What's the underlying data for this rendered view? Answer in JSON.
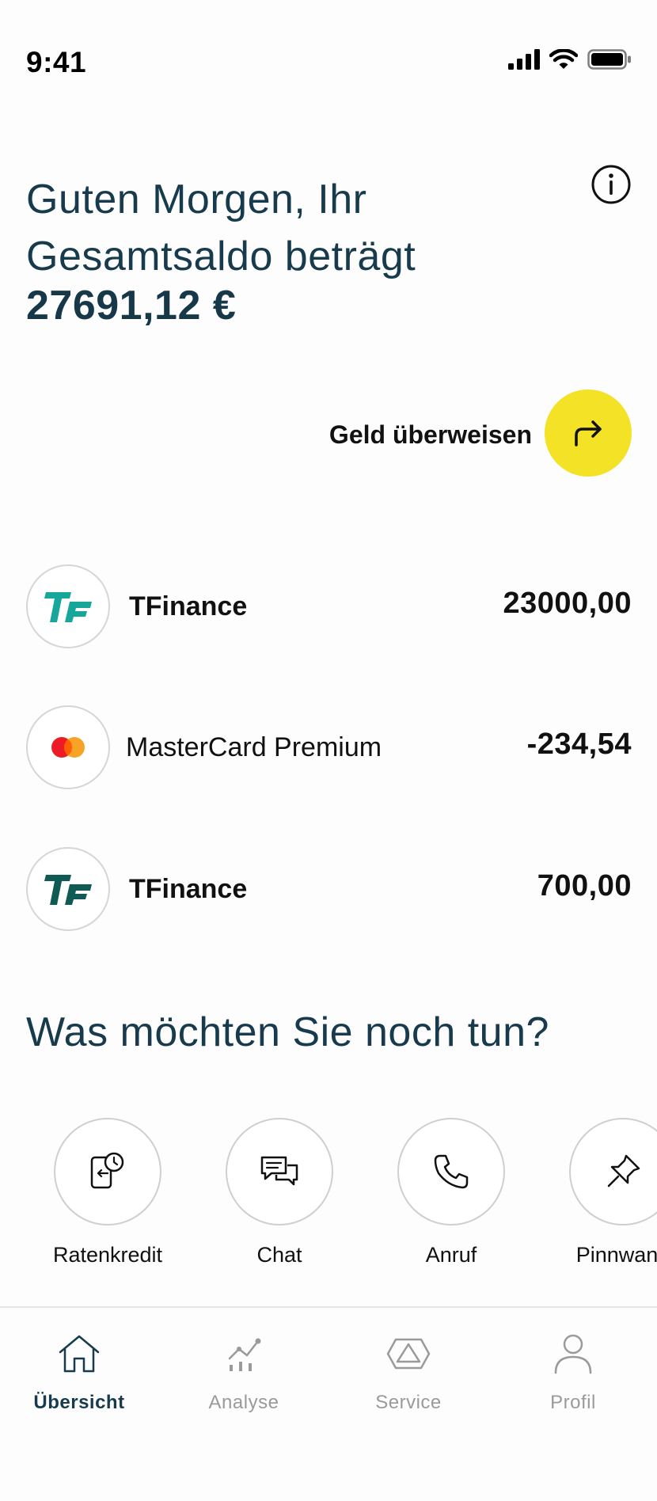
{
  "status_bar": {
    "time": "9:41",
    "icons": [
      "cellular-signal-icon",
      "wifi-icon",
      "battery-icon"
    ]
  },
  "header": {
    "info_icon": "info-icon",
    "greeting_line1": "Guten Morgen, Ihr",
    "greeting_line2": "Gesamtsaldo beträgt",
    "balance": "27691,12 €"
  },
  "transfer": {
    "label": "Geld überweisen",
    "icon": "arrow-turn-right-icon",
    "accent_color": "#f3e226"
  },
  "accounts": [
    {
      "name": "TFinance",
      "amount": "23000,00",
      "logo": "tfinance-logo",
      "logo_color": "#17a69a"
    },
    {
      "name": "MasterCard Premium",
      "amount": "-234,54",
      "logo": "mastercard-logo"
    },
    {
      "name": "TFinance",
      "amount": "700,00",
      "logo": "tfinance-logo",
      "logo_color": "#0f5a55"
    }
  ],
  "quick_actions": {
    "title": "Was möchten Sie noch tun?",
    "items": [
      {
        "label": "Ratenkredit",
        "icon": "loan-phone-icon"
      },
      {
        "label": "Chat",
        "icon": "chat-bubbles-icon"
      },
      {
        "label": "Anruf",
        "icon": "phone-icon"
      },
      {
        "label": "Pinnwand",
        "icon": "pin-icon"
      }
    ]
  },
  "bottom_nav": {
    "items": [
      {
        "label": "Übersicht",
        "icon": "home-icon",
        "active": true
      },
      {
        "label": "Analyse",
        "icon": "analytics-icon",
        "active": false
      },
      {
        "label": "Service",
        "icon": "service-triangle-icon",
        "active": false
      },
      {
        "label": "Profil",
        "icon": "profile-icon",
        "active": false
      }
    ]
  },
  "colors": {
    "primary_text": "#173b4d",
    "accent_yellow": "#f3e226",
    "inactive_nav": "#9a9a9a"
  }
}
